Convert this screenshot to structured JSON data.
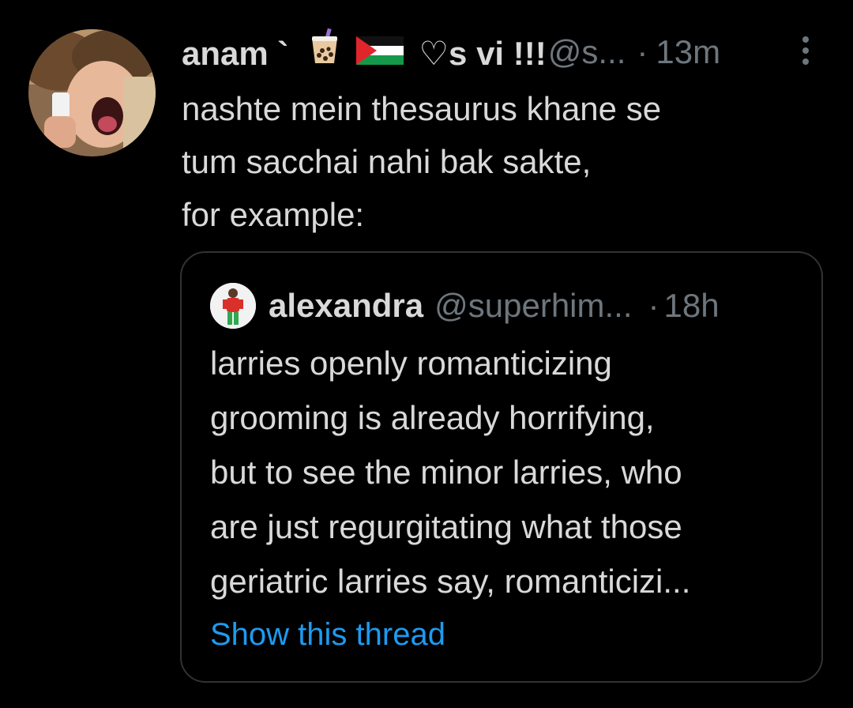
{
  "tweet": {
    "display_name_text": "anam `",
    "display_name_suffix": "♡s vi !!!",
    "emojis": [
      "bubble-tea-emoji",
      "palestine-flag-emoji"
    ],
    "handle": "@s...",
    "separator": "·",
    "time": "13m",
    "more_icon": "more-vertical-icon",
    "lines": [
      "nashte mein thesaurus khane se",
      "tum sacchai nahi bak sakte,",
      "for example:"
    ]
  },
  "quote": {
    "name": "alexandra",
    "handle": "@superhim...",
    "separator": "·",
    "time": "18h",
    "lines": [
      "larries openly romanticizing",
      "grooming is already horrifying,",
      "but to see the minor larries, who",
      "are just regurgitating what those",
      "geriatric larries say, romanticizi..."
    ],
    "show_thread": "Show this thread"
  },
  "colors": {
    "background": "#000000",
    "text": "#d9d9d9",
    "secondary": "#6e767d",
    "link": "#1d9bf0",
    "border": "#2f3336"
  }
}
